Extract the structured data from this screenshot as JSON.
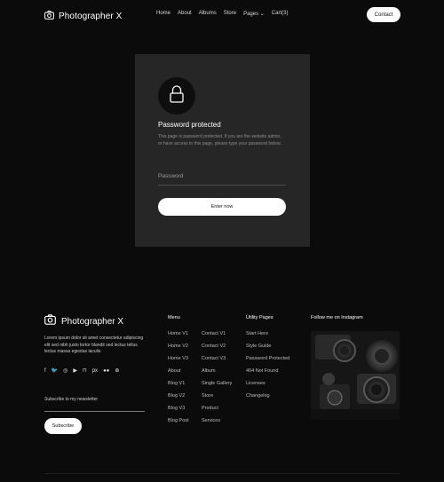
{
  "header": {
    "logo_text": "Photographer X",
    "nav": [
      {
        "label": "Home"
      },
      {
        "label": "About"
      },
      {
        "label": "Albums"
      },
      {
        "label": "Store"
      },
      {
        "label": "Pages ⌄"
      },
      {
        "label": "Cart(3)"
      }
    ],
    "contact_label": "Contact"
  },
  "card": {
    "title": "Password protected",
    "description": "This page is password protected. If you are the website admin, or have access to this page, please type your password below.",
    "password_placeholder": "Password",
    "button_label": "Enter now"
  },
  "footer": {
    "logo_text": "Photographer X",
    "description": "Lorem ipsum dolor sit amet consectetur adipiscing elit sed nibh justo tortor blandit sed lectus tellus lectus massa egestas iaculis",
    "newsletter_label": "Subscribe to my newsletter",
    "subscribe_label": "Subscribe",
    "social_icons": [
      "facebook-icon",
      "twitter-icon",
      "instagram-icon",
      "youtube-icon",
      "unsplash-icon",
      "500px-icon",
      "flickr-icon",
      "dribbble-icon"
    ],
    "social_glyphs": [
      "f",
      "🐦",
      "◎",
      "▶",
      "⊓",
      "px",
      "●●",
      "⊛"
    ],
    "menu": {
      "title": "Menu",
      "col1": [
        "Home V1",
        "Home V2",
        "Home V3",
        "About",
        "Blog V1",
        "Blog V2",
        "Blog V3",
        "Blog Post"
      ],
      "col2": [
        "Contact V1",
        "Contact V2",
        "Contact V3",
        "Album",
        "Single Gallery",
        "Store",
        "Product",
        "Services"
      ]
    },
    "utility": {
      "title": "Utility Pages",
      "items": [
        "Start Here",
        "Style Guide",
        "Password Protected",
        "404 Not Found",
        "Licenses",
        "Changelog"
      ]
    },
    "instagram": {
      "title": "Follow me on Instagram"
    }
  }
}
